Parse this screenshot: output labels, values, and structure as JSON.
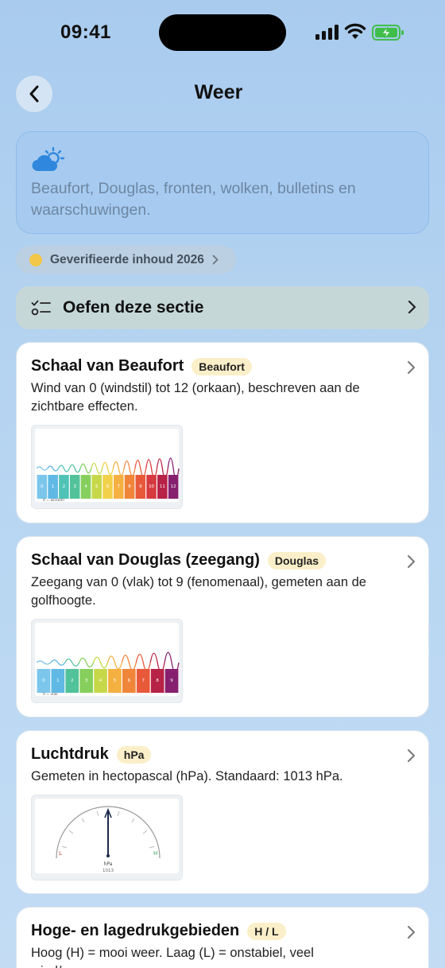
{
  "status": {
    "time": "09:41"
  },
  "nav": {
    "title": "Weer"
  },
  "intro": {
    "icon": "cloud-sun-icon",
    "text": "Beaufort, Douglas, fronten, wolken, bulletins en waarschuwingen."
  },
  "verified": {
    "label": "Geverifieerde inhoud 2026"
  },
  "practice": {
    "label": "Oefen deze sectie",
    "icon": "checklist-icon"
  },
  "cards": [
    {
      "title": "Schaal van Beaufort",
      "badge": "Beaufort",
      "description": "Wind van 0 (windstil) tot 12 (orkaan), beschreven aan de zichtbare effecten.",
      "scale": [
        "0",
        "1",
        "2",
        "3",
        "4",
        "5",
        "6",
        "7",
        "8",
        "9",
        "10",
        "11",
        "12"
      ],
      "caption": "0 = windstil"
    },
    {
      "title": "Schaal van Douglas (zeegang)",
      "badge": "Douglas",
      "description": "Zeegang van 0 (vlak) tot 9 (fenomenaal), gemeten aan de golfhoogte.",
      "scale": [
        "0",
        "1",
        "2",
        "3",
        "4",
        "5",
        "6",
        "7",
        "8",
        "9"
      ],
      "caption": "0 = vlak"
    },
    {
      "title": "Luchtdruk",
      "badge": "hPa",
      "description": "Gemeten in hectopascal (hPa). Standaard: 1013 hPa.",
      "gauge": {
        "low": "L",
        "high": "H",
        "unit": "hPa",
        "value": "1013"
      }
    },
    {
      "title": "Hoge- en lagedrukgebieden",
      "badge": "H / L",
      "description": "Hoog (H) = mooi weer. Laag (L) = onstabiel, veel wind/regen."
    }
  ],
  "colors": {
    "accent": "#2f88dd",
    "badge_bg": "#fbefc9",
    "scale": [
      "#7cc6ec",
      "#5fb9e4",
      "#4fc3b6",
      "#52c29a",
      "#86cf5d",
      "#c6d84a",
      "#f2d04a",
      "#f5b042",
      "#f0853a",
      "#e8593a",
      "#d63a3e",
      "#b72247",
      "#86206f"
    ]
  }
}
